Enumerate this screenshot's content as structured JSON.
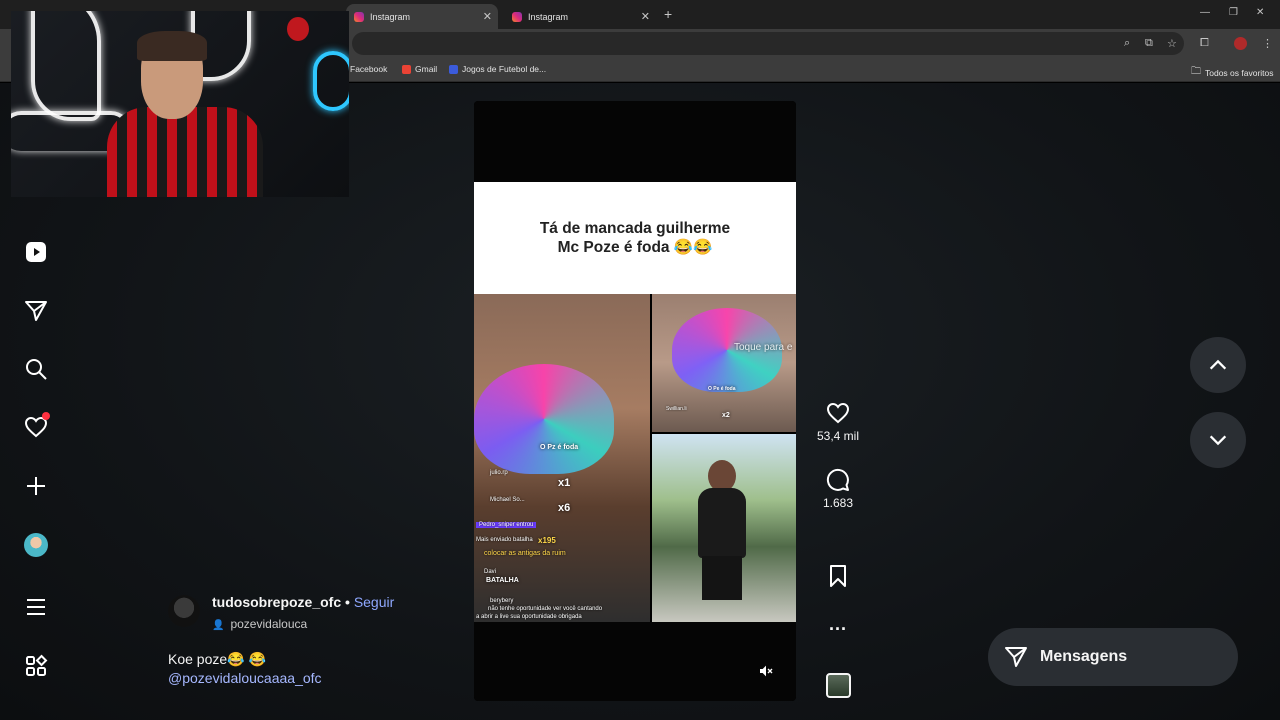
{
  "browser": {
    "tabs": [
      {
        "title": "Instagram",
        "active": true
      },
      {
        "title": "Instagram",
        "active": false
      }
    ],
    "new_tab": "+",
    "window_controls": [
      "—",
      "❐",
      "✕"
    ],
    "bookmarks": [
      {
        "label": "Facebook",
        "color": "#1877f2"
      },
      {
        "label": "Gmail",
        "color": "#ea4335"
      },
      {
        "label": "Jogos de Futebol de...",
        "color": "#3b5bdb"
      }
    ],
    "all_bookmarks": "Todos os favoritos"
  },
  "sidebar": {
    "items": [
      "reels-icon",
      "send-icon",
      "search-icon",
      "heart-icon",
      "create-icon",
      "profile-avatar",
      "menu-icon",
      "more-apps-icon"
    ]
  },
  "reel": {
    "caption_line1": "Tá de mancada guilherme",
    "caption_line2": "Mc Poze é foda 😂😂",
    "overlay_texts": {
      "toque": "Toque para e",
      "o_pe_foda_small": "O Pe é foda",
      "x2": "x2",
      "o_poze_foda": "O Pz é foda",
      "x1": "x1",
      "x6": "x6",
      "x195": "x195",
      "batalha": "BATALHA"
    },
    "chat": [
      "julio.rp",
      "Michael So...",
      "Pedro_sniper entrou",
      "Mais enviado batalha",
      "colocar as antigas da ruim",
      "Davi",
      "berybery",
      "não tenhe oportunidade ver você cantando",
      "a abrir a live sua oportunidade obrigada"
    ],
    "small_chat": "Swillian.li"
  },
  "actions": {
    "likes": "53,4 mil",
    "comments": "1.683",
    "more": "..."
  },
  "author": {
    "username": "tudosobrepoze_ofc",
    "separator": " • ",
    "follow": "Seguir",
    "audio": "pozevidalouca",
    "caption": "Koe poze😂 😂",
    "mention": "@pozevidaloucaaaa_ofc"
  },
  "messages_button": "Mensagens",
  "colors": {
    "accent_follow": "#8fa8ff",
    "notification": "#ff3040",
    "panel": "#2a2e33"
  }
}
